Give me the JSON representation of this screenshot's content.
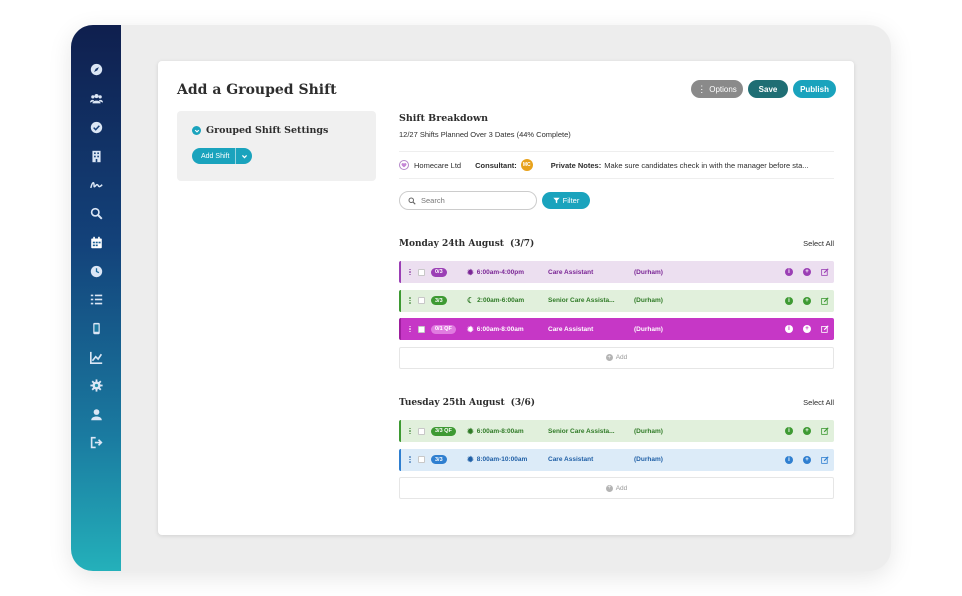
{
  "page": {
    "title": "Add a Grouped Shift",
    "actions": {
      "options": "Options",
      "save": "Save",
      "publish": "Publish"
    }
  },
  "sidebar": {
    "icons": [
      "compass-icon",
      "users-icon",
      "check-circle-icon",
      "building-icon",
      "signature-icon",
      "search-icon",
      "calendar-icon",
      "clock-icon",
      "list-icon",
      "mobile-icon",
      "chart-icon",
      "gear-icon",
      "user-icon",
      "sign-out-icon"
    ]
  },
  "settings": {
    "title": "Grouped Shift Settings",
    "add_shift": "Add Shift"
  },
  "breakdown": {
    "title": "Shift Breakdown",
    "subtitle": "12/27 Shifts Planned Over 3 Dates (44% Complete)",
    "client": "Homecare Ltd",
    "consultant_label": "Consultant:",
    "consultant_initials": "MC",
    "notes_label": "Private Notes:",
    "notes_text": "Make sure candidates check in with the manager before sta..."
  },
  "search": {
    "placeholder": "Search",
    "filter_label": "Filter"
  },
  "days": [
    {
      "title": "Monday 24th August",
      "count": "(3/7)",
      "select_all": "Select All",
      "add_label": "Add",
      "shifts": [
        {
          "badge": "0/3",
          "time": "6:00am-4:00pm",
          "time_icon": "sun",
          "role": "Care Assistant",
          "location": "(Durham)",
          "theme": "purple-light"
        },
        {
          "badge": "3/3",
          "time": "2:00am-6:00am",
          "time_icon": "moon",
          "role": "Senior Care Assista...",
          "location": "(Durham)",
          "theme": "green"
        },
        {
          "badge": "0/1 QF",
          "time": "6:00am-8:00am",
          "time_icon": "sun",
          "role": "Care Assistant",
          "location": "(Durham)",
          "theme": "magenta"
        }
      ]
    },
    {
      "title": "Tuesday 25th August",
      "count": "(3/6)",
      "select_all": "Select All",
      "add_label": "Add",
      "shifts": [
        {
          "badge": "3/3 QF",
          "time": "6:00am-8:00am",
          "time_icon": "sun",
          "role": "Senior Care Assista...",
          "location": "(Durham)",
          "theme": "green"
        },
        {
          "badge": "3/3",
          "time": "8:00am-10:00am",
          "time_icon": "sun",
          "role": "Care Assistant",
          "location": "(Durham)",
          "theme": "blue"
        }
      ]
    }
  ],
  "colors": {
    "accent": "#1aa3bd",
    "save": "#1f6e74",
    "options": "#8a8a8a",
    "purple-light": {
      "bg": "#ecdff0",
      "border": "#9b3fb5",
      "text": "#7a2595",
      "badge": "#9b3fb5"
    },
    "green": {
      "bg": "#e1f0dc",
      "border": "#3e9a33",
      "text": "#2f7a26",
      "badge": "#3e9a33"
    },
    "magenta": {
      "bg": "#c637c6",
      "border": "#9d1e9d",
      "text": "#ffffff",
      "badge": "#e07be0"
    },
    "blue": {
      "bg": "#dcebf8",
      "border": "#2f7fd0",
      "text": "#1f5fa6",
      "badge": "#2f7fd0"
    }
  }
}
